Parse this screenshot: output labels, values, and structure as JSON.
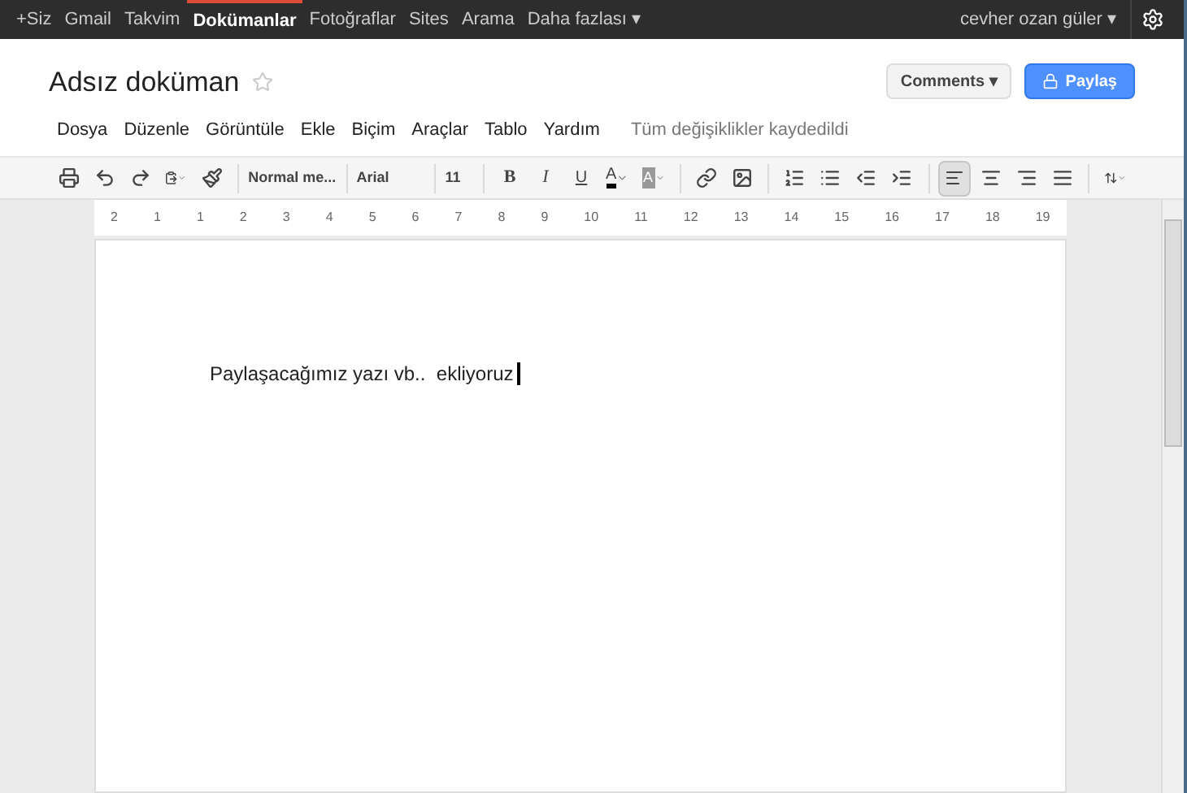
{
  "topbar": {
    "links": [
      {
        "label": "+Siz",
        "selected": false
      },
      {
        "label": "Gmail",
        "selected": false
      },
      {
        "label": "Takvim",
        "selected": false
      },
      {
        "label": "Dokümanlar",
        "selected": true
      },
      {
        "label": "Fotoğraflar",
        "selected": false
      },
      {
        "label": "Sites",
        "selected": false
      },
      {
        "label": "Arama",
        "selected": false
      },
      {
        "label": "Daha fazlası ▾",
        "selected": false
      }
    ],
    "user": "cevher ozan güler ▾"
  },
  "document": {
    "title": "Adsız doküman",
    "starred": false,
    "body": "Paylaşacağımız yazı vb..  ekliyoruz"
  },
  "menu": [
    "Dosya",
    "Düzenle",
    "Görüntüle",
    "Ekle",
    "Biçim",
    "Araçlar",
    "Tablo",
    "Yardım"
  ],
  "save_status": "Tüm değişiklikler kaydedildi",
  "comments_button": "Comments ▾",
  "share_button": "Paylaş",
  "toolbar": {
    "style": "Normal me...",
    "font": "Arial",
    "size": "11",
    "bold": "B",
    "italic": "I",
    "underline": "U",
    "text_color": "A",
    "highlight": "A",
    "alignment": [
      {
        "kind": "left",
        "selected": true
      },
      {
        "kind": "center",
        "selected": false
      },
      {
        "kind": "right",
        "selected": false
      },
      {
        "kind": "justify",
        "selected": false
      }
    ]
  },
  "ruler": [
    "2",
    "1",
    "1",
    "2",
    "3",
    "4",
    "5",
    "6",
    "7",
    "8",
    "9",
    "10",
    "11",
    "12",
    "13",
    "14",
    "15",
    "16",
    "17",
    "18",
    "19"
  ]
}
